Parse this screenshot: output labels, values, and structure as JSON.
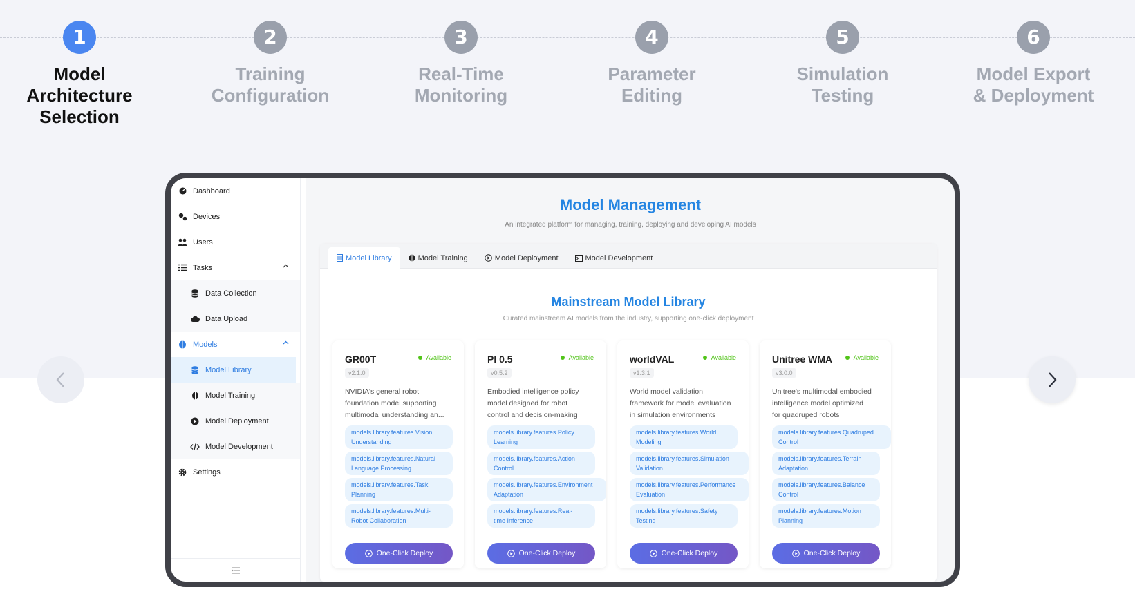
{
  "steps": [
    {
      "number": "1",
      "line1": "Model",
      "line2": "Architecture",
      "line3": "Selection",
      "active": true
    },
    {
      "number": "2",
      "line1": "Training",
      "line2": "Configuration",
      "line3": ""
    },
    {
      "number": "3",
      "line1": "Real-Time",
      "line2": "Monitoring",
      "line3": ""
    },
    {
      "number": "4",
      "line1": "Parameter",
      "line2": "Editing",
      "line3": ""
    },
    {
      "number": "5",
      "line1": "Simulation",
      "line2": "Testing",
      "line3": ""
    },
    {
      "number": "6",
      "line1": "Model Export",
      "line2": "& Deployment",
      "line3": ""
    }
  ],
  "sidebar": {
    "dashboard": "Dashboard",
    "devices": "Devices",
    "users": "Users",
    "tasks": "Tasks",
    "data_collection": "Data Collection",
    "data_upload": "Data Upload",
    "models": "Models",
    "model_library": "Model Library",
    "model_training": "Model Training",
    "model_deployment": "Model Deployment",
    "model_development": "Model Development",
    "settings": "Settings"
  },
  "main": {
    "title": "Model Management",
    "subtitle": "An integrated platform for managing, training, deploying and developing AI models",
    "tabs": [
      "Model Library",
      "Model Training",
      "Model Deployment",
      "Model Development"
    ],
    "library_title": "Mainstream Model Library",
    "library_subtitle": "Curated mainstream AI models from the industry, supporting one-click deployment"
  },
  "cards": [
    {
      "name": "GR00T",
      "status": "Available",
      "version": "v2.1.0",
      "desc1": "NVIDIA's general robot",
      "desc2": "foundation model supporting",
      "desc3": "multimodal understanding an...",
      "f1a": "models.library.features.Vision",
      "f1b": "Understanding",
      "f2a": "models.library.features.Natural",
      "f2b": "Language Processing",
      "f3a": "models.library.features.Task",
      "f3b": "Planning",
      "f4a": "models.library.features.Multi-",
      "f4b": "Robot Collaboration",
      "deploy": "One-Click Deploy"
    },
    {
      "name": "PI 0.5",
      "status": "Available",
      "version": "v0.5.2",
      "desc1": "Embodied intelligence policy",
      "desc2": "model designed for robot",
      "desc3": "control and decision-making",
      "f1a": "models.library.features.Policy",
      "f1b": "Learning",
      "f2a": "models.library.features.Action",
      "f2b": "Control",
      "f3a": "models.library.features.Environment",
      "f3b": "Adaptation",
      "f4a": "models.library.features.Real-",
      "f4b": "time Inference",
      "deploy": "One-Click Deploy"
    },
    {
      "name": "worldVAL",
      "status": "Available",
      "version": "v1.3.1",
      "desc1": "World model validation",
      "desc2": "framework for model evaluation",
      "desc3": "in simulation environments",
      "f1a": "models.library.features.World",
      "f1b": "Modeling",
      "f2a": "models.library.features.Simulation",
      "f2b": "Validation",
      "f3a": "models.library.features.Performance",
      "f3b": "Evaluation",
      "f4a": "models.library.features.Safety",
      "f4b": "Testing",
      "deploy": "One-Click Deploy"
    },
    {
      "name": "Unitree WMA",
      "status": "Available",
      "version": "v3.0.0",
      "desc1": "Unitree's multimodal embodied",
      "desc2": "intelligence model optimized",
      "desc3": "for quadruped robots",
      "f1a": "models.library.features.Quadruped",
      "f1b": "Control",
      "f2a": "models.library.features.Terrain",
      "f2b": "Adaptation",
      "f3a": "models.library.features.Balance",
      "f3b": "Control",
      "f4a": "models.library.features.Motion",
      "f4b": "Planning",
      "deploy": "One-Click Deploy"
    }
  ],
  "colors": {
    "accent": "#4a86f0",
    "title_blue": "#2585e2",
    "available_green": "#52c41a",
    "deploy_gradient_start": "#5b6de4",
    "deploy_gradient_end": "#7457c6"
  },
  "icons": {
    "prev": "chevron-left-icon",
    "next": "chevron-right-icon"
  }
}
